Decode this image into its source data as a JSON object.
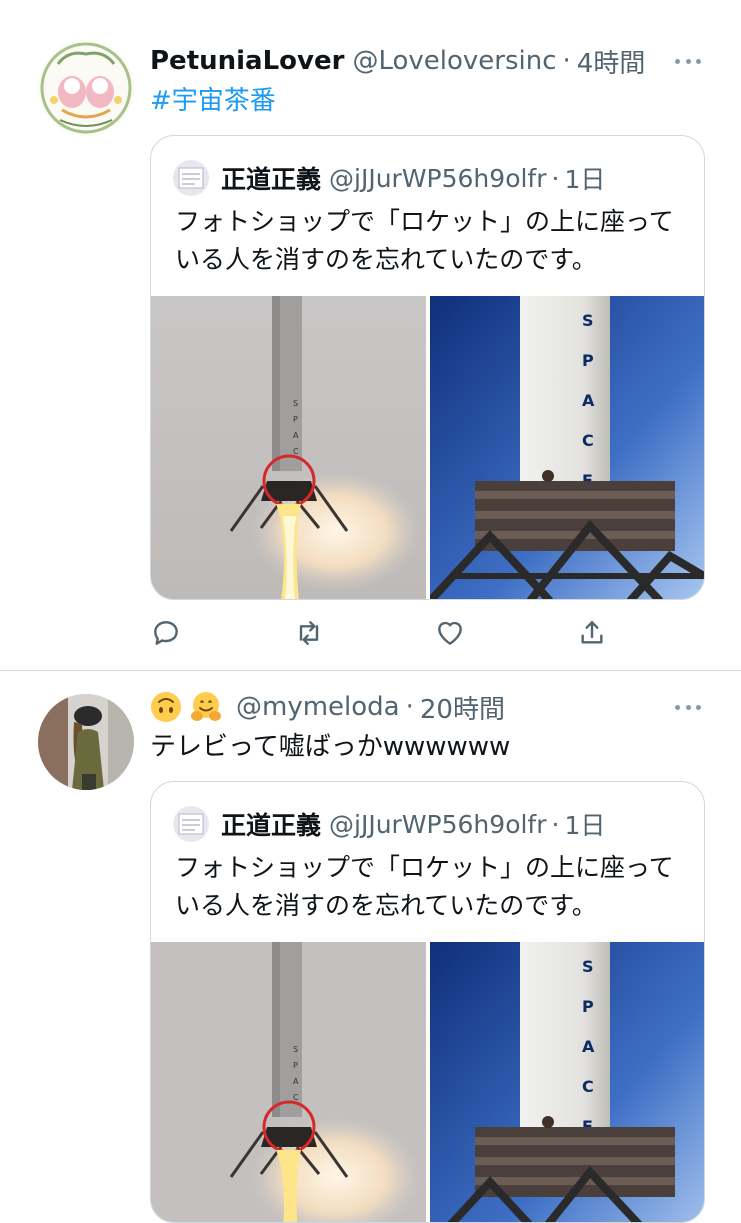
{
  "tweets": [
    {
      "name": "PetuniaLover",
      "handle": "@Loveloversinc",
      "separator": "·",
      "time": "4時間",
      "text": "#宇宙茶番",
      "quote": {
        "name": "正道正義",
        "handle": "@jJJurWP56h9olfr",
        "separator": "·",
        "time": "1日",
        "text": "フォトショップで「ロケット」の上に座っている人を消すのを忘れていたのです。",
        "media": [
          "rocket-landing-photo",
          "spacex-rocket-closeup-photo"
        ]
      },
      "actions": [
        "reply-icon",
        "retweet-icon",
        "like-icon",
        "share-icon"
      ]
    },
    {
      "name_emojis": [
        "upside-down-face",
        "hugging-face"
      ],
      "handle": "@mymeloda",
      "separator": "·",
      "time": "20時間",
      "text": "テレビって嘘ばっかwwwwww",
      "quote": {
        "name": "正道正義",
        "handle": "@jJJurWP56h9olfr",
        "separator": "·",
        "time": "1日",
        "text": "フォトショップで「ロケット」の上に座っている人を消すのを忘れていたのです。",
        "media": [
          "rocket-landing-photo",
          "spacex-rocket-closeup-photo"
        ]
      }
    }
  ],
  "colors": {
    "text": "#0f1419",
    "secondary": "#536471",
    "link": "#1d9bf0",
    "border": "#cfd9de",
    "emoji": "#ffcc4d"
  }
}
